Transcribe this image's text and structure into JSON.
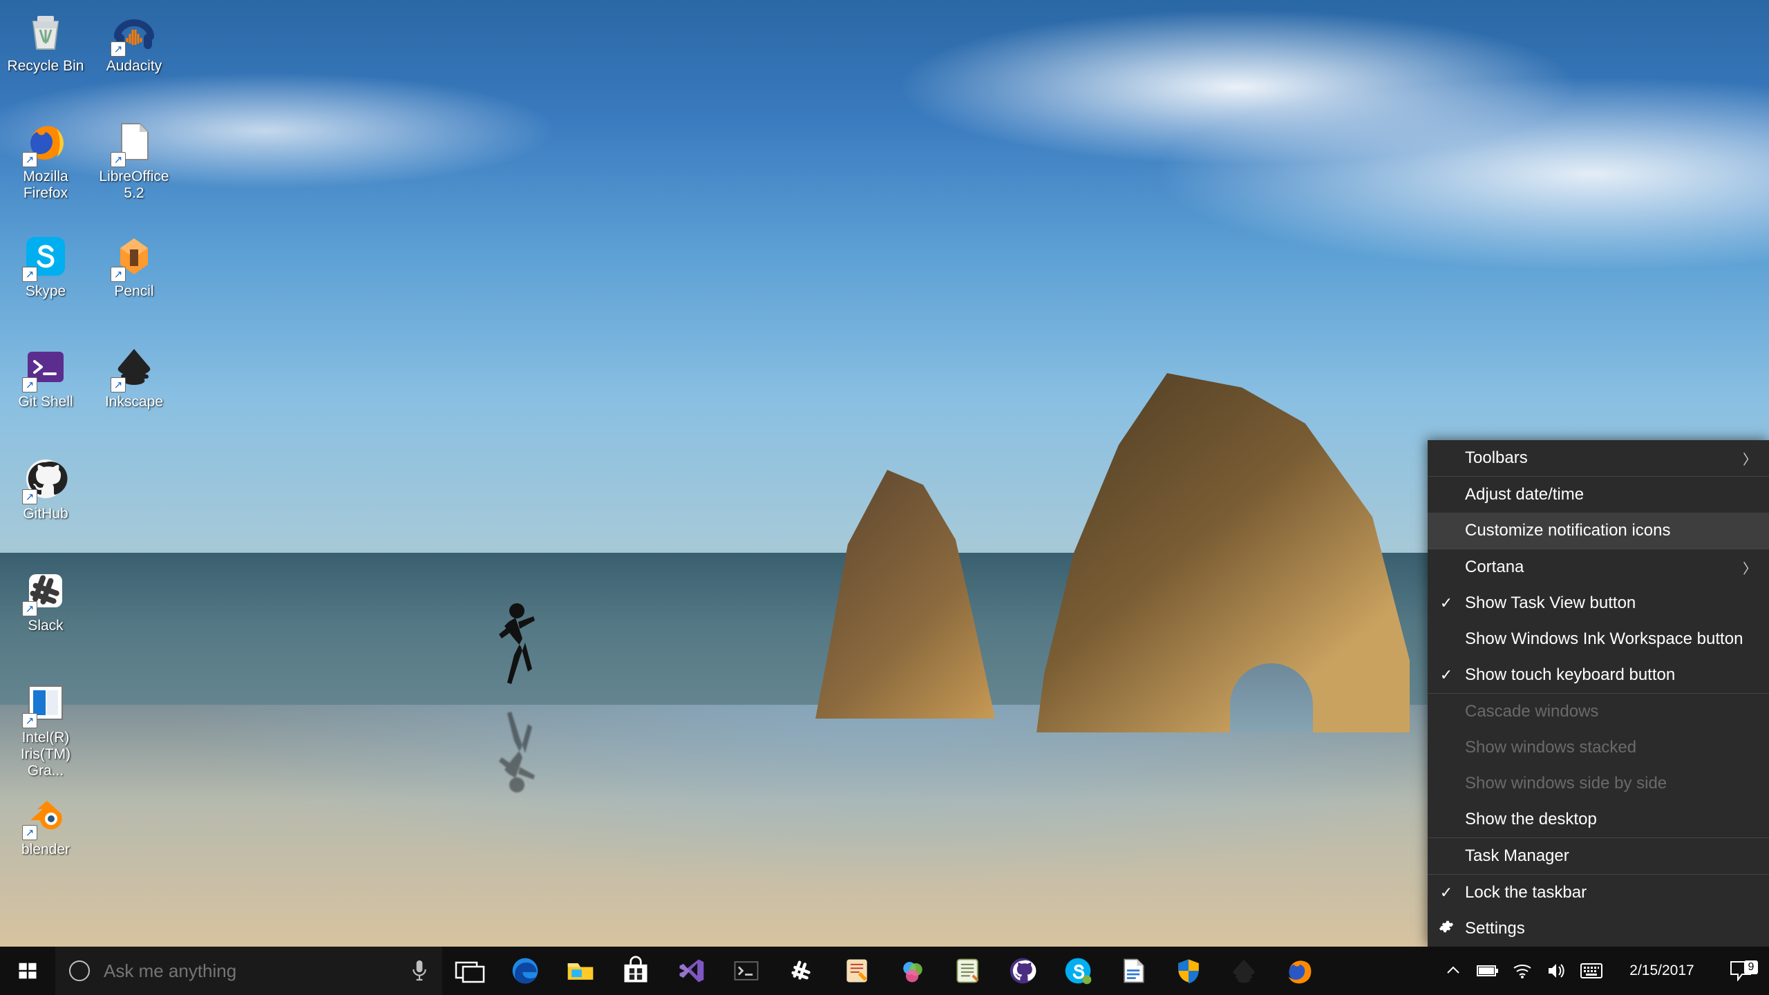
{
  "desktop_icons": {
    "recycle_bin": "Recycle Bin",
    "audacity": "Audacity",
    "firefox": "Mozilla Firefox",
    "libreoffice": "LibreOffice 5.2",
    "skype": "Skype",
    "pencil": "Pencil",
    "git_shell": "Git Shell",
    "inkscape": "Inkscape",
    "github": "GitHub",
    "slack": "Slack",
    "intel": "Intel(R) Iris(TM) Gra...",
    "blender": "blender"
  },
  "context_menu": {
    "toolbars": "Toolbars",
    "adjust_datetime": "Adjust date/time",
    "customize_icons": "Customize notification icons",
    "cortana": "Cortana",
    "show_task_view": "Show Task View button",
    "show_ink": "Show Windows Ink Workspace button",
    "show_touch_kb": "Show touch keyboard button",
    "cascade": "Cascade windows",
    "stacked": "Show windows stacked",
    "side_by_side": "Show windows side by side",
    "show_desktop": "Show the desktop",
    "task_manager": "Task Manager",
    "lock_taskbar": "Lock the taskbar",
    "settings": "Settings"
  },
  "taskbar": {
    "search_placeholder": "Ask me anything",
    "date": "2/15/2017",
    "action_center_count": "9"
  },
  "tray_icon_names": {
    "overflow": "show-hidden-icons",
    "battery": "battery-icon",
    "wifi": "wifi-icon",
    "volume": "volume-icon",
    "keyboard": "touch-keyboard-icon"
  },
  "pinned_app_names": [
    "edge",
    "file-explorer",
    "store",
    "visual-studio",
    "terminal",
    "slack",
    "sublime",
    "paint-dot-net",
    "notepad-plus-plus",
    "github",
    "skype",
    "libreoffice-writer",
    "defender",
    "inkscape",
    "firefox"
  ]
}
